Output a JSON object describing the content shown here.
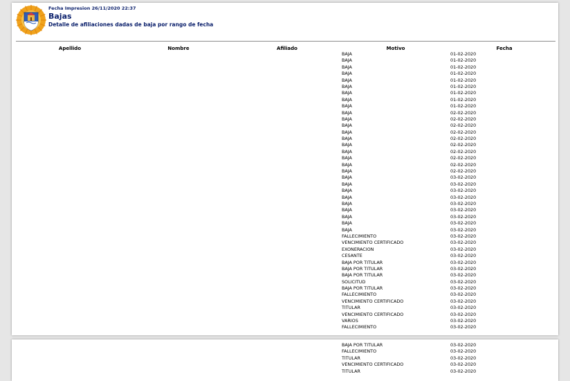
{
  "header": {
    "print_date": "Fecha Impresion 26/11/2020 22:37",
    "title": "Bajas",
    "subtitle": "Detalle de afiliaciones dadas de baja por rango de fecha"
  },
  "logo_icon": "provincial-crest-icon",
  "colors": {
    "header_text": "#0a1f6b",
    "logo_ring": "#f0a21c",
    "logo_shield": "#2d5db8"
  },
  "table": {
    "columns": [
      "Apellido",
      "Nombre",
      "Afiliado",
      "Motivo",
      "Fecha"
    ],
    "page1_rows": [
      {
        "motivo": "BAJA",
        "fecha": "01-02-2020"
      },
      {
        "motivo": "BAJA",
        "fecha": "01-02-2020"
      },
      {
        "motivo": "BAJA",
        "fecha": "01-02-2020"
      },
      {
        "motivo": "BAJA",
        "fecha": "01-02-2020"
      },
      {
        "motivo": "BAJA",
        "fecha": "01-02-2020"
      },
      {
        "motivo": "BAJA",
        "fecha": "01-02-2020"
      },
      {
        "motivo": "BAJA",
        "fecha": "01-02-2020"
      },
      {
        "motivo": "BAJA",
        "fecha": "01-02-2020"
      },
      {
        "motivo": "BAJA",
        "fecha": "01-02-2020"
      },
      {
        "motivo": "BAJA",
        "fecha": "02-02-2020"
      },
      {
        "motivo": "BAJA",
        "fecha": "02-02-2020"
      },
      {
        "motivo": "BAJA",
        "fecha": "02-02-2020"
      },
      {
        "motivo": "BAJA",
        "fecha": "02-02-2020"
      },
      {
        "motivo": "BAJA",
        "fecha": "02-02-2020"
      },
      {
        "motivo": "BAJA",
        "fecha": "02-02-2020"
      },
      {
        "motivo": "BAJA",
        "fecha": "02-02-2020"
      },
      {
        "motivo": "BAJA",
        "fecha": "02-02-2020"
      },
      {
        "motivo": "BAJA",
        "fecha": "02-02-2020"
      },
      {
        "motivo": "BAJA",
        "fecha": "02-02-2020"
      },
      {
        "motivo": "BAJA",
        "fecha": "03-02-2020"
      },
      {
        "motivo": "BAJA",
        "fecha": "03-02-2020"
      },
      {
        "motivo": "BAJA",
        "fecha": "03-02-2020"
      },
      {
        "motivo": "BAJA",
        "fecha": "03-02-2020"
      },
      {
        "motivo": "BAJA",
        "fecha": "03-02-2020"
      },
      {
        "motivo": "BAJA",
        "fecha": "03-02-2020"
      },
      {
        "motivo": "BAJA",
        "fecha": "03-02-2020"
      },
      {
        "motivo": "BAJA",
        "fecha": "03-02-2020"
      },
      {
        "motivo": "BAJA",
        "fecha": "03-02-2020"
      },
      {
        "motivo": "FALLECIMIENTO",
        "fecha": "03-02-2020"
      },
      {
        "motivo": "VENCIMIENTO CERTIFICADO",
        "fecha": "03-02-2020"
      },
      {
        "motivo": "EXONERACION",
        "fecha": "03-02-2020"
      },
      {
        "motivo": "CESANTE",
        "fecha": "03-02-2020"
      },
      {
        "motivo": "BAJA POR TITULAR",
        "fecha": "03-02-2020"
      },
      {
        "motivo": "BAJA POR TITULAR",
        "fecha": "03-02-2020"
      },
      {
        "motivo": "BAJA POR TITULAR",
        "fecha": "03-02-2020"
      },
      {
        "motivo": "SOLICITUD",
        "fecha": "03-02-2020"
      },
      {
        "motivo": "BAJA POR TITULAR",
        "fecha": "03-02-2020"
      },
      {
        "motivo": "FALLECIMIENTO",
        "fecha": "03-02-2020"
      },
      {
        "motivo": "VENCIMIENTO CERTIFICADO",
        "fecha": "03-02-2020"
      },
      {
        "motivo": "TITULAR",
        "fecha": "03-02-2020"
      },
      {
        "motivo": "VENCIMIENTO CERTIFICADO",
        "fecha": "03-02-2020"
      },
      {
        "motivo": "VARIOS",
        "fecha": "03-02-2020"
      },
      {
        "motivo": "FALLECIMIENTO",
        "fecha": "03-02-2020"
      }
    ],
    "page2_rows": [
      {
        "motivo": "BAJA POR TITULAR",
        "fecha": "03-02-2020"
      },
      {
        "motivo": "FALLECIMIENTO",
        "fecha": "03-02-2020"
      },
      {
        "motivo": "TITULAR",
        "fecha": "03-02-2020"
      },
      {
        "motivo": "VENCIMIENTO CERTIFICADO",
        "fecha": "03-02-2020"
      },
      {
        "motivo": "TITULAR",
        "fecha": "03-02-2020"
      }
    ]
  }
}
